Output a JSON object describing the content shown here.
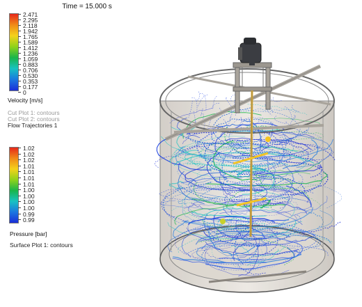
{
  "time_label": "Time = 15.000 s",
  "velocity_legend": {
    "ticks": [
      "2.471",
      "2.295",
      "2.118",
      "1.942",
      "1.765",
      "1.589",
      "1.412",
      "1.236",
      "1.059",
      "0.883",
      "0.706",
      "0.530",
      "0.353",
      "0.177",
      "0"
    ],
    "unit": "Velocity [m/s]",
    "colors": [
      "#e6281a",
      "#f08a18",
      "#f4d21a",
      "#8fd21a",
      "#19b54a",
      "#17c2c2",
      "#1a78e0",
      "#1a2ed8"
    ]
  },
  "plots": {
    "cut_plot_1": "Cut Plot 1: contours",
    "cut_plot_2": "Cut Plot 2: contours",
    "flow_trajectories": "Flow Trajectories 1"
  },
  "pressure_legend": {
    "ticks": [
      "1.02",
      "1.02",
      "1.02",
      "1.01",
      "1.01",
      "1.01",
      "1.01",
      "1.00",
      "1.00",
      "1.00",
      "1.00",
      "0.99",
      "0.99"
    ],
    "unit": "Pressure [bar]",
    "colors": [
      "#e6281a",
      "#f08a18",
      "#f4d21a",
      "#8fd21a",
      "#19b54a",
      "#17c2c2",
      "#1a78e0",
      "#1a2ed8"
    ]
  },
  "surface_plot": "Surface Plot 1: contours"
}
